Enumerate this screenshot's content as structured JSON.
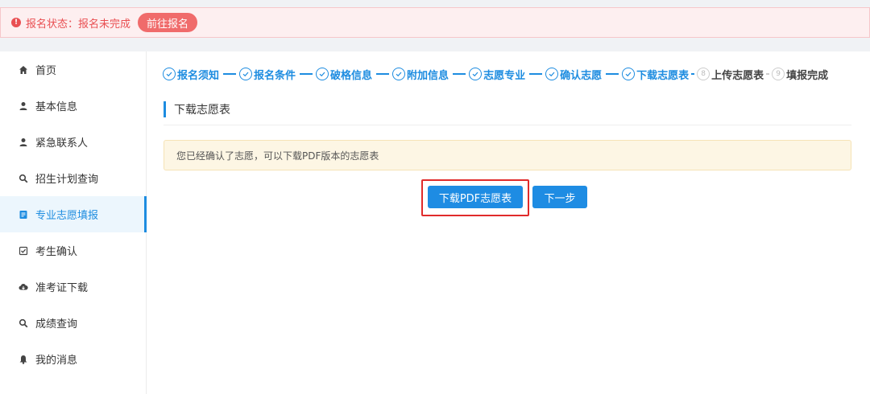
{
  "alert": {
    "icon": "exclamation-circle-icon",
    "text": "报名状态：报名未完成",
    "button_label": "前往报名",
    "color": "#e94f52"
  },
  "sidebar": {
    "items": [
      {
        "label": "首页",
        "icon": "home-icon"
      },
      {
        "label": "基本信息",
        "icon": "user-icon"
      },
      {
        "label": "紧急联系人",
        "icon": "user-icon"
      },
      {
        "label": "招生计划查询",
        "icon": "search-icon"
      },
      {
        "label": "专业志愿填报",
        "icon": "document-icon",
        "active": true
      },
      {
        "label": "考生确认",
        "icon": "checkbox-icon"
      },
      {
        "label": "准考证下载",
        "icon": "cloud-download-icon"
      },
      {
        "label": "成绩查询",
        "icon": "search-icon"
      },
      {
        "label": "我的消息",
        "icon": "bell-icon"
      }
    ]
  },
  "steps": [
    {
      "label": "报名须知",
      "status": "done"
    },
    {
      "label": "报名条件",
      "status": "done"
    },
    {
      "label": "破格信息",
      "status": "done"
    },
    {
      "label": "附加信息",
      "status": "done"
    },
    {
      "label": "志愿专业",
      "status": "done"
    },
    {
      "label": "确认志愿",
      "status": "done"
    },
    {
      "label": "下载志愿表",
      "status": "current"
    },
    {
      "label": "上传志愿表",
      "status": "pending",
      "number": "8"
    },
    {
      "label": "填报完成",
      "status": "pending",
      "number": "9"
    }
  ],
  "main": {
    "section_title": "下载志愿表",
    "notice": "您已经确认了志愿，可以下载PDF版本的志愿表",
    "download_button": "下载PDF志愿表",
    "next_button": "下一步"
  },
  "colors": {
    "accent": "#1d8ce0",
    "highlight": "#e02b2b",
    "notice_bg": "#fdf6e4"
  }
}
